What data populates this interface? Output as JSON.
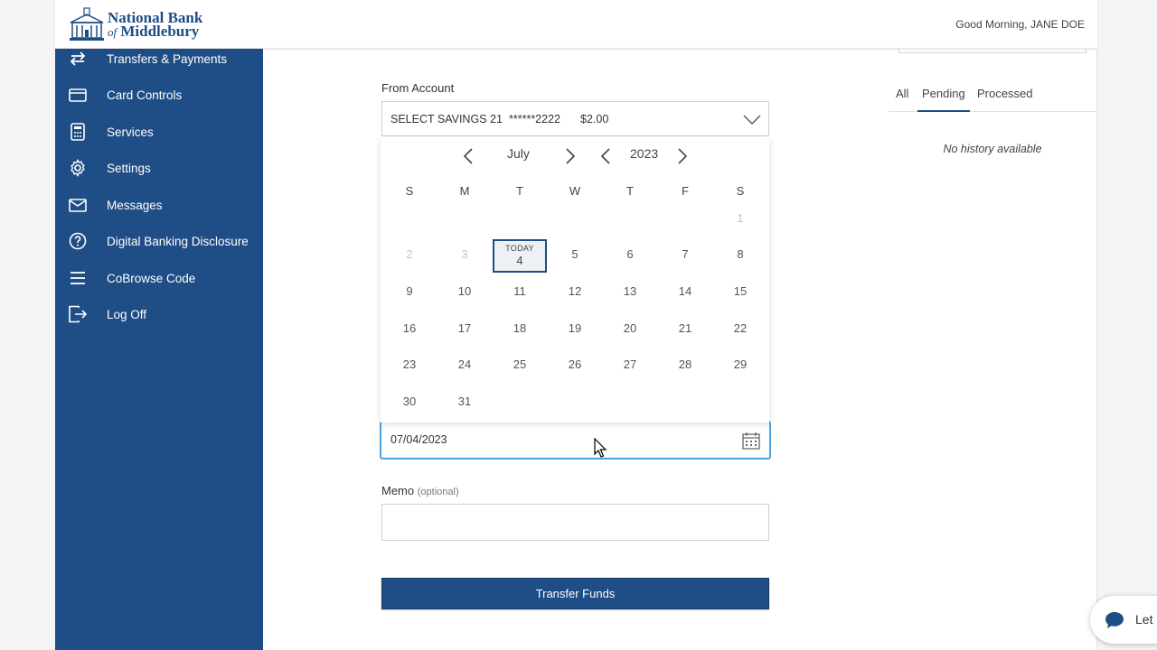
{
  "header": {
    "bank_name_line1": "National Bank",
    "bank_name_of": "of",
    "bank_name_line2": "Middlebury",
    "greeting": "Good Morning, JANE DOE"
  },
  "sidebar": {
    "items": [
      {
        "label": "Transfers & Payments",
        "icon": "transfer-arrows-icon"
      },
      {
        "label": "Card Controls",
        "icon": "card-icon"
      },
      {
        "label": "Services",
        "icon": "calculator-icon"
      },
      {
        "label": "Settings",
        "icon": "gear-icon"
      },
      {
        "label": "Messages",
        "icon": "envelope-icon"
      },
      {
        "label": "Digital Banking Disclosure",
        "icon": "question-circle-icon"
      },
      {
        "label": "CoBrowse Code",
        "icon": "hamburger-icon"
      },
      {
        "label": "Log Off",
        "icon": "logout-icon"
      }
    ]
  },
  "form": {
    "from_account_label": "From Account",
    "from_account_name": "SELECT SAVINGS 21",
    "from_account_number": "******2222",
    "from_account_balance": "$2.00",
    "date_value": "07/04/2023",
    "memo_label": "Memo",
    "memo_optional": "(optional)",
    "memo_value": "",
    "submit_label": "Transfer Funds"
  },
  "calendar": {
    "month": "July",
    "year": "2023",
    "weekdays": [
      "S",
      "M",
      "T",
      "W",
      "T",
      "F",
      "S"
    ],
    "today_label": "TODAY",
    "today_day": "4",
    "weeks": [
      [
        "",
        "",
        "",
        "",
        "",
        "",
        "1"
      ],
      [
        "2",
        "3",
        "4",
        "5",
        "6",
        "7",
        "8"
      ],
      [
        "9",
        "10",
        "11",
        "12",
        "13",
        "14",
        "15"
      ],
      [
        "16",
        "17",
        "18",
        "19",
        "20",
        "21",
        "22"
      ],
      [
        "23",
        "24",
        "25",
        "26",
        "27",
        "28",
        "29"
      ],
      [
        "30",
        "31",
        "",
        "",
        "",
        "",
        ""
      ]
    ],
    "disabled_days": [
      "1",
      "2",
      "3"
    ]
  },
  "history": {
    "tabs": [
      "All",
      "Pending",
      "Processed"
    ],
    "active_tab": "Pending",
    "empty_text": "No history available"
  },
  "chat": {
    "label": "Let"
  },
  "colors": {
    "brand": "#1f4d85",
    "focus": "#4aa3e0"
  }
}
